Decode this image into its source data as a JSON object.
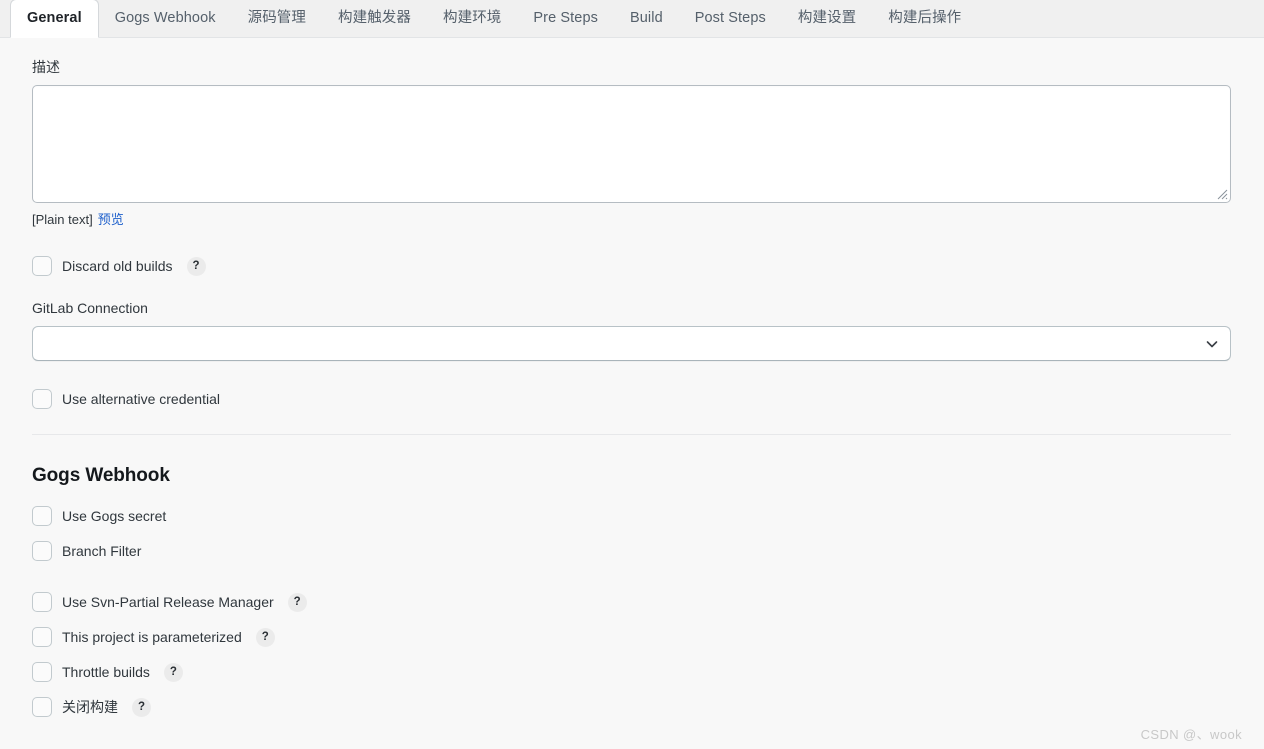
{
  "tabs": [
    {
      "label": "General",
      "active": true
    },
    {
      "label": "Gogs Webhook",
      "active": false
    },
    {
      "label": "源码管理",
      "active": false
    },
    {
      "label": "构建触发器",
      "active": false
    },
    {
      "label": "构建环境",
      "active": false
    },
    {
      "label": "Pre Steps",
      "active": false
    },
    {
      "label": "Build",
      "active": false
    },
    {
      "label": "Post Steps",
      "active": false
    },
    {
      "label": "构建设置",
      "active": false
    },
    {
      "label": "构建后操作",
      "active": false
    }
  ],
  "description": {
    "label": "描述",
    "value": "",
    "placeholder": "",
    "markup_note": "[Plain text]",
    "preview_label": "预览"
  },
  "general": {
    "discard_old_builds": {
      "label": "Discard old builds",
      "checked": false,
      "help": "?"
    },
    "gitlab_connection": {
      "label": "GitLab Connection",
      "selected": "",
      "options": [
        ""
      ]
    },
    "use_alternative_credential": {
      "label": "Use alternative credential",
      "checked": false
    }
  },
  "gogs_webhook": {
    "title": "Gogs Webhook",
    "items": [
      {
        "label": "Use Gogs secret",
        "checked": false,
        "help": null
      },
      {
        "label": "Branch Filter",
        "checked": false,
        "help": null
      }
    ]
  },
  "project_options": [
    {
      "label": "Use Svn-Partial Release Manager",
      "checked": false,
      "help": "?"
    },
    {
      "label": "This project is parameterized",
      "checked": false,
      "help": "?"
    },
    {
      "label": "Throttle builds",
      "checked": false,
      "help": "?"
    },
    {
      "label": "关闭构建",
      "checked": false,
      "help": "?"
    }
  ],
  "watermark": "CSDN @、wook",
  "colors": {
    "page_bg": "#f8f8f8",
    "tabbar_bg": "#f0f0f0",
    "active_tab_bg": "#ffffff",
    "link": "#1d5fcb",
    "text": "#30373d",
    "border": "#b8c2c7"
  }
}
